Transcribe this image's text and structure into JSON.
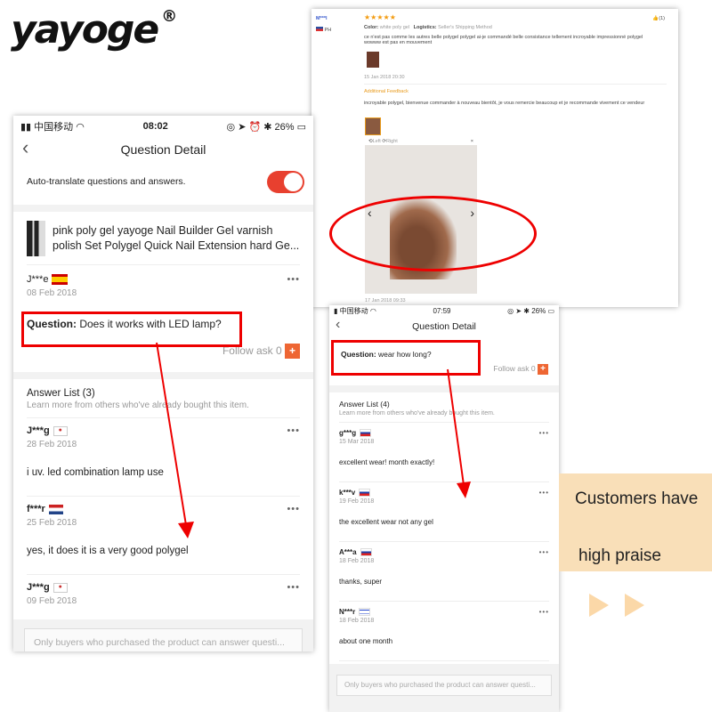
{
  "logo": {
    "text": "yayoge",
    "mark": "®"
  },
  "review": {
    "user": "M***l",
    "country": "PH",
    "stars": "★★★★★",
    "color_label": "Color:",
    "color_value": "white poly gel",
    "logistics_label": "Logistics:",
    "logistics_value": "Seller's Shipping Method",
    "text": "ce n'est pas comme les autres belle polygel polygel ai-je commandé belle consistance tellement incroyable impressionné polygel wowww est pas en mouvement",
    "date": "15 Jan 2018 20:30",
    "likes": "(1)",
    "additional_label": "Additional Feedback",
    "additional_text": "incroyable polygel, bienvenue commander à nouveau bientôt, je vous remercie beaucoup et je recommande vivement ce vendeur",
    "viewer": {
      "left": "Left",
      "right": "Right",
      "close": "×"
    },
    "additional_date": "17 Jan 2018 09:33"
  },
  "left_phone": {
    "status": {
      "carrier": "中国移动",
      "time": "08:02",
      "battery": "26%"
    },
    "title": "Question Detail",
    "auto_translate": "Auto-translate questions and answers.",
    "auto_translate_on": true,
    "product": "pink poly gel yayoge Nail Builder Gel varnish polish Set Polygel Quick Nail Extension hard Ge...",
    "asker": "J***e",
    "asker_flag": "ES",
    "ask_date": "08 Feb 2018",
    "question_label": "Question:",
    "question": "Does it works with LED lamp?",
    "follow": "Follow ask 0",
    "answer_list": "Answer List (3)",
    "answer_sub": "Learn more from others who've already bought this item.",
    "answers": [
      {
        "user": "J***g",
        "flag": "KR",
        "date": "28 Feb 2018",
        "text": "i uv. led combination lamp use"
      },
      {
        "user": "f***r",
        "flag": "NL",
        "date": "25 Feb 2018",
        "text": "yes, it does it is a very good polygel"
      },
      {
        "user": "J***g",
        "flag": "KR",
        "date": "09 Feb 2018",
        "text": ""
      }
    ],
    "input_placeholder": "Only buyers who purchased the product can answer questi..."
  },
  "right_phone": {
    "status": {
      "carrier": "中国移动",
      "time": "07:59",
      "battery": "26%"
    },
    "title": "Question Detail",
    "question_label": "Question:",
    "question": "wear how long?",
    "follow": "Follow ask 0",
    "answer_list": "Answer List (4)",
    "answer_sub": "Learn more from others who've already bought this item.",
    "answers": [
      {
        "user": "g***g",
        "flag": "RU",
        "date": "15 Mar 2018",
        "text": "excellent wear! month exactly!"
      },
      {
        "user": "k***v",
        "flag": "RU",
        "date": "19 Feb 2018",
        "text": "the excellent wear not any gel"
      },
      {
        "user": "A***a",
        "flag": "SK",
        "date": "18 Feb 2018",
        "text": "thanks, super"
      },
      {
        "user": "N***r",
        "flag": "IL",
        "date": "18 Feb 2018",
        "text": "about one month"
      }
    ],
    "input_placeholder": "Only buyers who purchased the product can answer questi..."
  },
  "promo": {
    "line1": "Customers have",
    "line2": "high praise"
  },
  "colors": {
    "accent_red": "#e8402f",
    "highlight_red": "#ee0000",
    "star": "#f39c12",
    "beige": "#f9dfb8"
  }
}
